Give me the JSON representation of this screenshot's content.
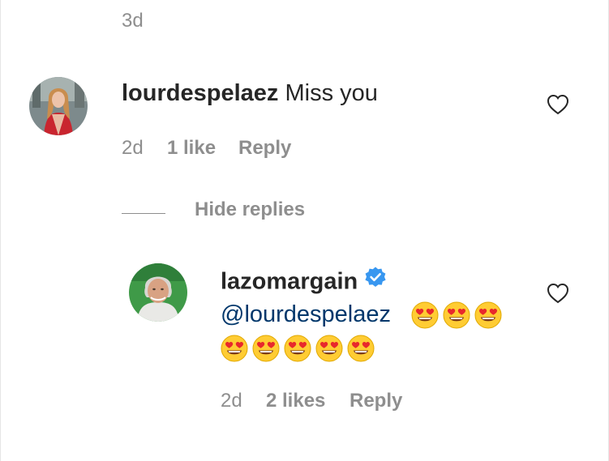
{
  "top_comment_meta": {
    "time": "3d"
  },
  "comment": {
    "username": "lourdespelaez",
    "text": "Miss you",
    "time": "2d",
    "likes": "1 like",
    "reply_label": "Reply"
  },
  "replies_toggle": {
    "label": "Hide replies"
  },
  "reply": {
    "username": "lazomargain",
    "verified": true,
    "mention": "@lourdespelaez",
    "emoji": "heart-eyes-emoji",
    "emoji_count": 8,
    "time": "2d",
    "likes": "2 likes",
    "reply_label": "Reply"
  },
  "colors": {
    "text": "#262626",
    "secondary": "#8e8e8e",
    "mention": "#00376b",
    "verified": "#3897f0"
  }
}
